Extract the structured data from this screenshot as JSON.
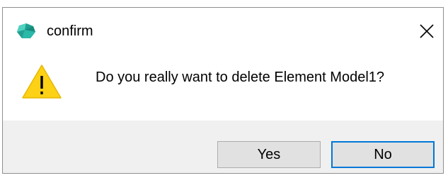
{
  "window": {
    "title": "confirm",
    "app_icon": "teal-gem-icon",
    "close_icon": "close-icon"
  },
  "dialog": {
    "icon": "warning-icon",
    "message": "Do you really want to delete Element Model1?"
  },
  "buttons": {
    "yes_label": "Yes",
    "no_label": "No"
  },
  "colors": {
    "footer_bg": "#f0f0f0",
    "button_bg": "#e1e1e1",
    "focus_border": "#0078d7",
    "warning_fill": "#fcd116",
    "icon_teal": "#2aa198"
  }
}
